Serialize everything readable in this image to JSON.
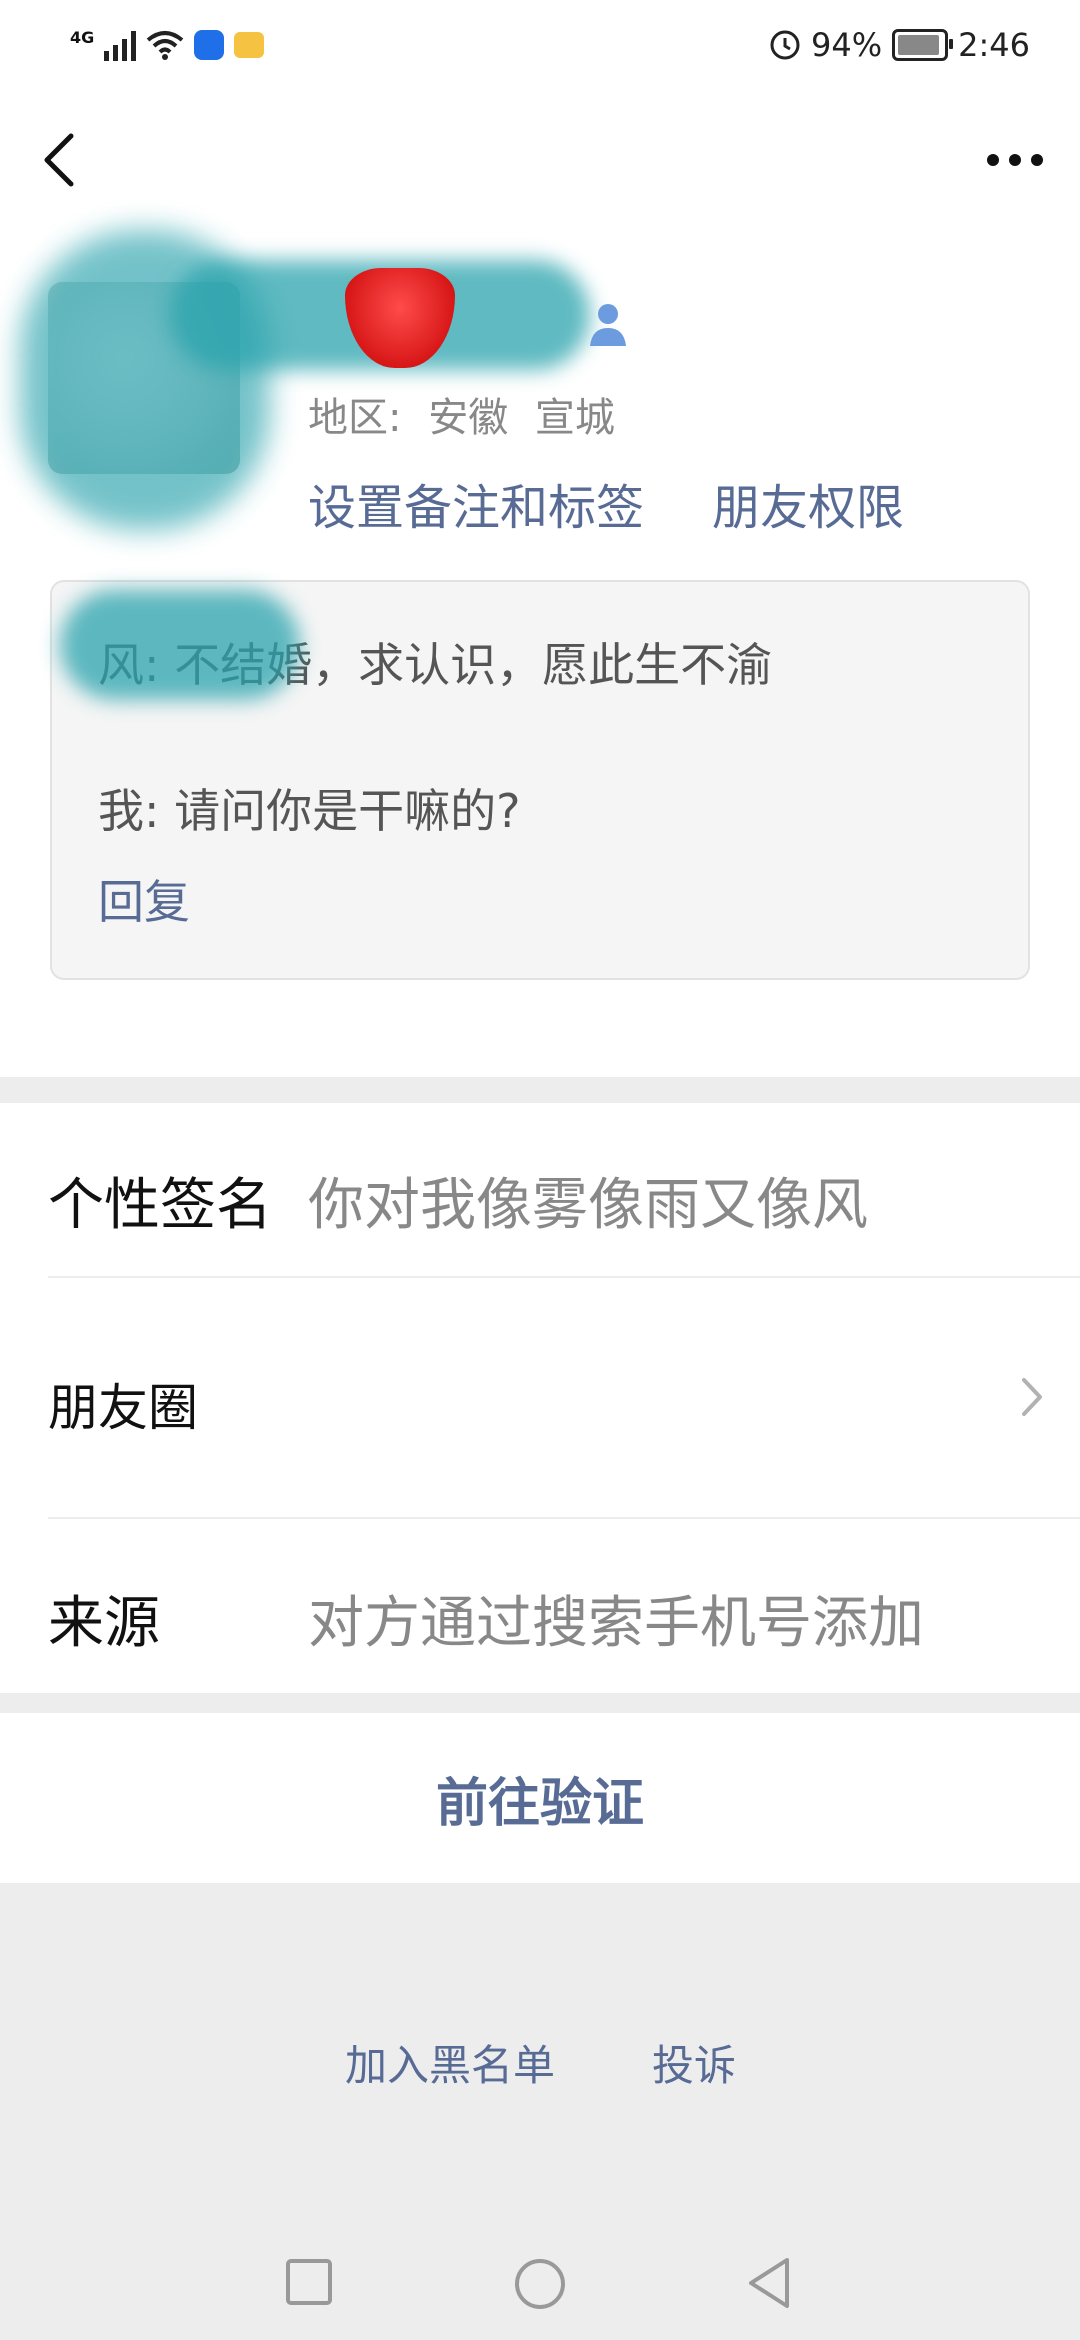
{
  "status_bar": {
    "network": "4G",
    "battery": "94%",
    "battery_level": 0.94,
    "time": "2:46"
  },
  "profile": {
    "region_label": "地区:",
    "region_province": "安徽",
    "region_city": "宣城",
    "set_remark_link": "设置备注和标签",
    "friend_permission_link": "朋友权限"
  },
  "message": {
    "line1": "风: 不结婚，求认识，愿此生不渝",
    "line2": "我: 请问你是干嘛的?",
    "reply": "回复"
  },
  "info_rows": {
    "signature_label": "个性签名",
    "signature_value": "你对我像雾像雨又像风",
    "moments_label": "朋友圈",
    "source_label": "来源",
    "source_value": "对方通过搜索手机号添加"
  },
  "actions": {
    "verify": "前往验证",
    "blacklist": "加入黑名单",
    "report": "投诉"
  },
  "icons": {
    "back": "back-arrow-icon",
    "more": "more-dots-icon",
    "person": "person-icon",
    "chevron": "chevron-right-icon",
    "nav_recent": "square-icon",
    "nav_home": "circle-icon",
    "nav_back": "triangle-back-icon"
  },
  "colors": {
    "link": "#576b95",
    "secondary_text": "#888888",
    "page_background": "#ededed"
  }
}
